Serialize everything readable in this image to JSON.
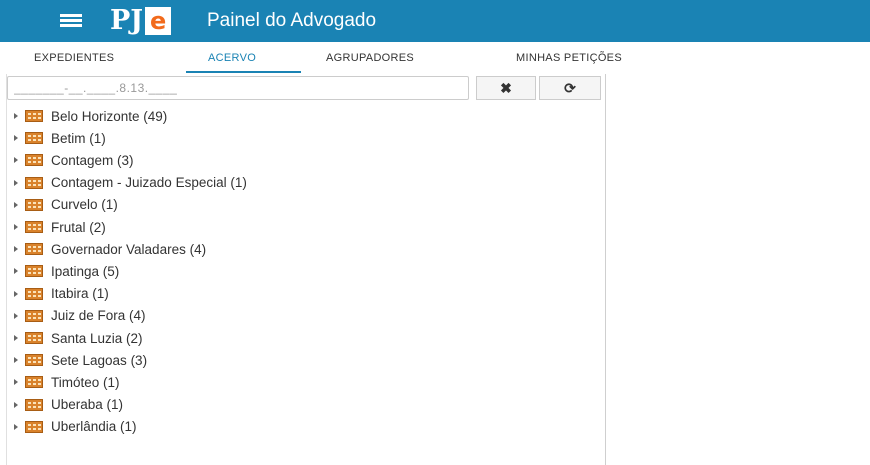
{
  "header": {
    "logo_text": "PJ",
    "logo_e": "e",
    "title": "Painel do Advogado",
    "accent_color": "#1a83b4"
  },
  "tabs": [
    {
      "label": "EXPEDIENTES",
      "active": false
    },
    {
      "label": "ACERVO",
      "active": true
    },
    {
      "label": "AGRUPADORES",
      "active": false
    },
    {
      "label": "MINHAS PETIÇÕES",
      "active": false
    }
  ],
  "search": {
    "placeholder": "_______-__.____.8.13.____",
    "value": "",
    "clear_label": "✖",
    "refresh_label": "⟳",
    "clear_icon": "close-icon",
    "refresh_icon": "refresh-icon"
  },
  "tree": {
    "items": [
      {
        "label": "Belo Horizonte (49)"
      },
      {
        "label": "Betim (1)"
      },
      {
        "label": "Contagem (3)"
      },
      {
        "label": "Contagem - Juizado Especial (1)"
      },
      {
        "label": "Curvelo (1)"
      },
      {
        "label": "Frutal (2)"
      },
      {
        "label": "Governador Valadares (4)"
      },
      {
        "label": "Ipatinga (5)"
      },
      {
        "label": "Itabira (1)"
      },
      {
        "label": "Juiz de Fora (4)"
      },
      {
        "label": "Santa Luzia (2)"
      },
      {
        "label": "Sete Lagoas (3)"
      },
      {
        "label": "Timóteo (1)"
      },
      {
        "label": "Uberaba (1)"
      },
      {
        "label": "Uberlândia (1)"
      }
    ]
  }
}
